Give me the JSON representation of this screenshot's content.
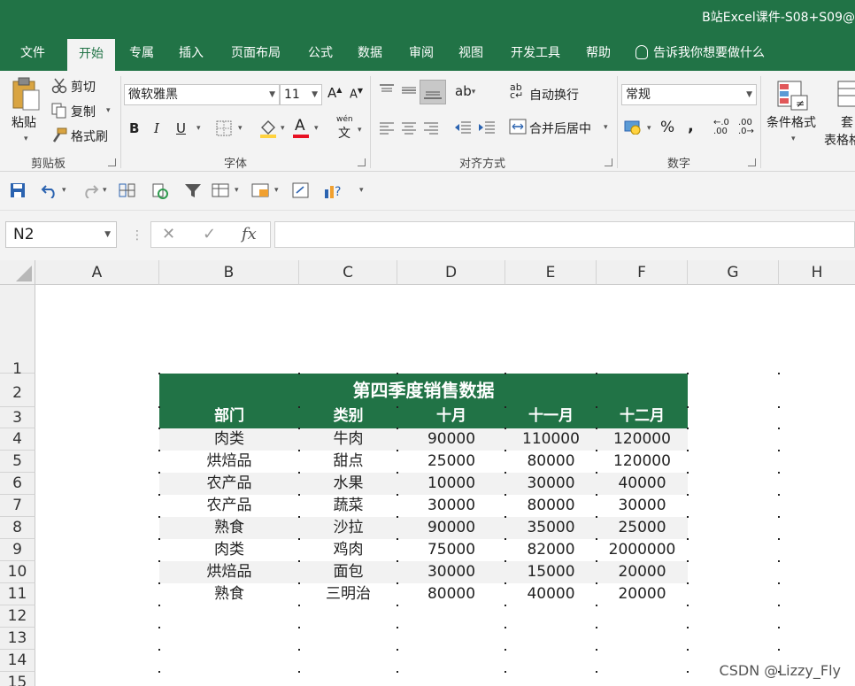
{
  "window": {
    "title": "B站Excel课件-S08+S09@"
  },
  "tabs": [
    "文件",
    "开始",
    "专属",
    "插入",
    "页面布局",
    "公式",
    "数据",
    "审阅",
    "视图",
    "开发工具",
    "帮助"
  ],
  "active_tab": "开始",
  "tell_me": "告诉我你想要做什么",
  "ribbon": {
    "clipboard": {
      "paste": "粘贴",
      "cut": "剪切",
      "copy": "复制",
      "format_painter": "格式刷",
      "label": "剪贴板"
    },
    "font": {
      "font_name": "微软雅黑",
      "font_size": "11",
      "bold": "B",
      "italic": "I",
      "underline": "U",
      "phonetic": "wén",
      "label": "字体"
    },
    "alignment": {
      "wrap_text": "自动换行",
      "merge_center": "合并后居中",
      "label": "对齐方式"
    },
    "number": {
      "format": "常规",
      "percent": "%",
      "comma": ",",
      "inc_decimal": ".00",
      "dec_decimal": ".0",
      "label": "数字"
    },
    "styles": {
      "conditional_format": "条件格式",
      "table_format_1": "套",
      "table_format_2": "表格格"
    }
  },
  "formula_bar": {
    "name_box": "N2",
    "cancel": "✕",
    "enter": "✓",
    "fx": "fx",
    "content": ""
  },
  "columns": [
    "A",
    "B",
    "C",
    "D",
    "E",
    "F",
    "G",
    "H"
  ],
  "rows": [
    "1",
    "2",
    "3",
    "4",
    "5",
    "6",
    "7",
    "8",
    "9",
    "10",
    "11",
    "12",
    "13",
    "14",
    "15"
  ],
  "table": {
    "title": "第四季度销售数据",
    "headers": [
      "部门",
      "类别",
      "十月",
      "十一月",
      "十二月"
    ],
    "rows": [
      [
        "肉类",
        "牛肉",
        "90000",
        "110000",
        "120000"
      ],
      [
        "烘焙品",
        "甜点",
        "25000",
        "80000",
        "120000"
      ],
      [
        "农产品",
        "水果",
        "10000",
        "30000",
        "40000"
      ],
      [
        "农产品",
        "蔬菜",
        "30000",
        "80000",
        "30000"
      ],
      [
        "熟食",
        "沙拉",
        "90000",
        "35000",
        "25000"
      ],
      [
        "肉类",
        "鸡肉",
        "75000",
        "82000",
        "2000000"
      ],
      [
        "烘焙品",
        "面包",
        "30000",
        "15000",
        "20000"
      ],
      [
        "熟食",
        "三明治",
        "80000",
        "40000",
        "20000"
      ]
    ]
  },
  "watermark": "CSDN @Lizzy_Fly",
  "colors": {
    "excel_green": "#217346",
    "band_gray": "#f2f2f2",
    "ribbon_bg": "#f3f3f3"
  }
}
